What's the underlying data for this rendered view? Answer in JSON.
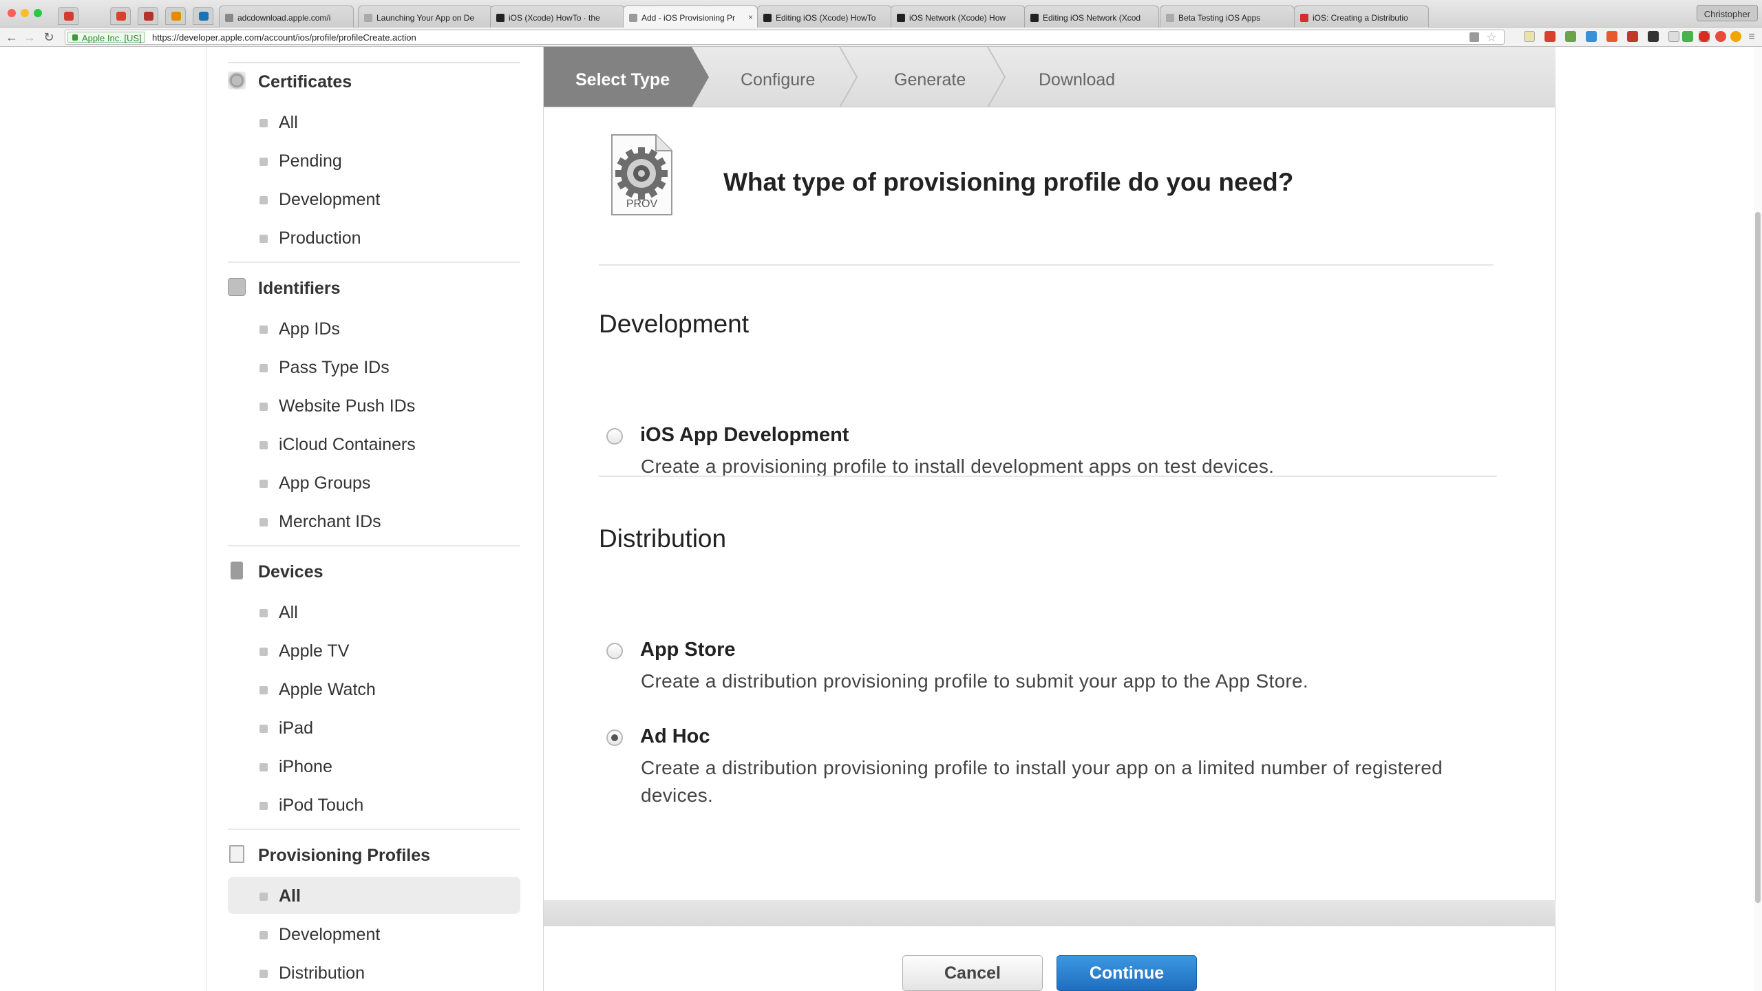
{
  "browser": {
    "tabs": [
      {
        "label": "adcdownload.apple.com/i",
        "active": false
      },
      {
        "label": "Launching Your App on De",
        "active": false
      },
      {
        "label": "iOS (Xcode) HowTo · the",
        "active": false
      },
      {
        "label": "Add - iOS Provisioning Pr",
        "active": true
      },
      {
        "label": "Editing iOS (Xcode) HowTo",
        "active": false
      },
      {
        "label": "iOS Network (Xcode) How",
        "active": false
      },
      {
        "label": "Editing iOS Network (Xcod",
        "active": false
      },
      {
        "label": "Beta Testing iOS Apps",
        "active": false
      },
      {
        "label": "iOS: Creating a Distributio",
        "active": false
      }
    ],
    "close_glyph": "×",
    "profile_name": "Christopher",
    "ev_label": "Apple Inc. [US]",
    "url": "https://developer.apple.com/account/ios/profile/profileCreate.action"
  },
  "sidebar": {
    "sections": [
      {
        "title": "Certificates",
        "icon": "certificate-icon",
        "items": [
          "All",
          "Pending",
          "Development",
          "Production"
        ]
      },
      {
        "title": "Identifiers",
        "icon": "id-icon",
        "items": [
          "App IDs",
          "Pass Type IDs",
          "Website Push IDs",
          "iCloud Containers",
          "App Groups",
          "Merchant IDs"
        ]
      },
      {
        "title": "Devices",
        "icon": "device-icon",
        "items": [
          "All",
          "Apple TV",
          "Apple Watch",
          "iPad",
          "iPhone",
          "iPod Touch"
        ]
      },
      {
        "title": "Provisioning Profiles",
        "icon": "document-icon",
        "items": [
          "All",
          "Development",
          "Distribution"
        ],
        "selected": "All"
      }
    ]
  },
  "steps": [
    "Select Type",
    "Configure",
    "Generate",
    "Download"
  ],
  "active_step": "Select Type",
  "main": {
    "icon_label": "PROV",
    "question": "What type of provisioning profile do you need?",
    "groups": [
      {
        "title": "Development",
        "options": [
          {
            "title": "iOS App Development",
            "description": "Create a provisioning profile to install development apps on test devices.",
            "selected": false
          }
        ]
      },
      {
        "title": "Distribution",
        "options": [
          {
            "title": "App Store",
            "description": "Create a distribution provisioning profile to submit your app to the App Store.",
            "selected": false
          },
          {
            "title": "Ad Hoc",
            "description": "Create a distribution provisioning profile to install your app on a limited number of registered devices.",
            "selected": true
          }
        ]
      }
    ],
    "cancel_label": "Cancel",
    "continue_label": "Continue"
  },
  "colors": {
    "accent": "#1f6fc0",
    "step_active": "#8a8a8a"
  }
}
